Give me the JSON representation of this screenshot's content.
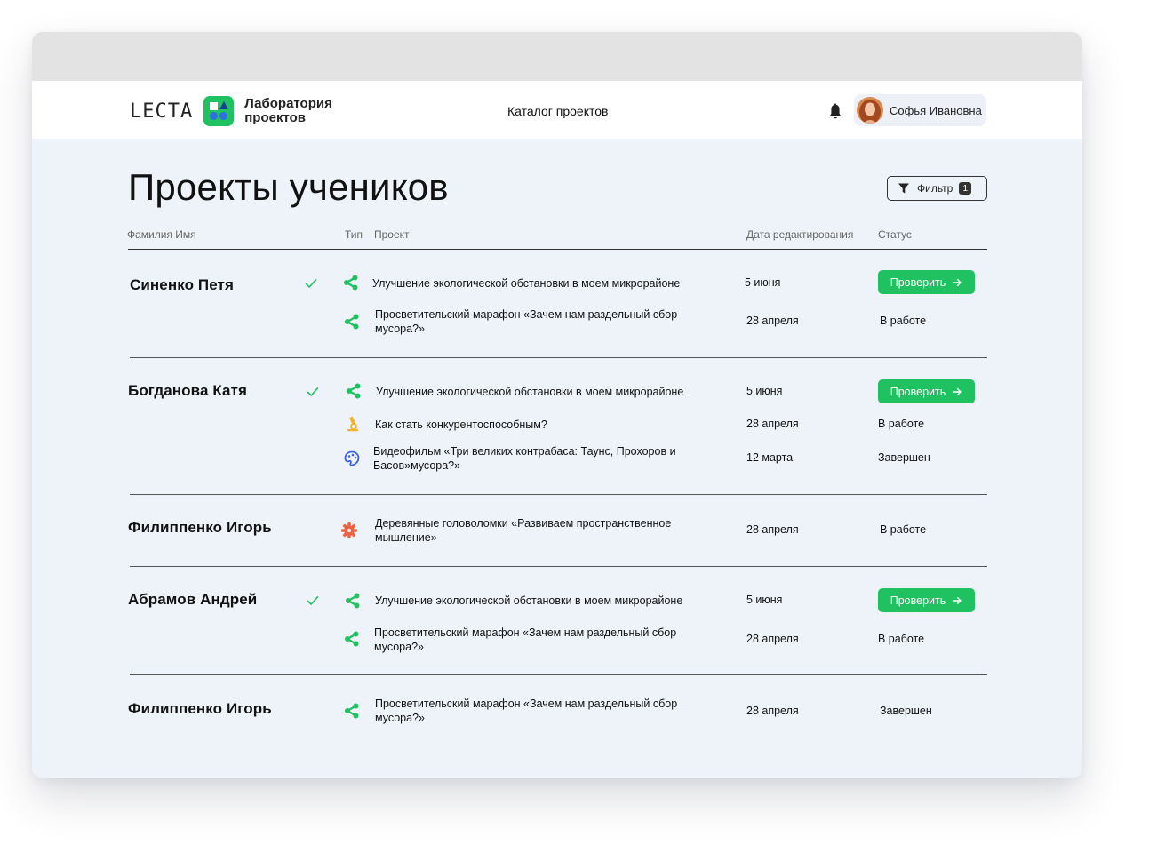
{
  "header": {
    "brand_wordmark": "LECTA",
    "brand_name": "Лаборатория проектов",
    "nav_link": "Каталог проектов",
    "user_name": "Софья Ивановна"
  },
  "page": {
    "title": "Проекты учеников",
    "filter_label": "Фильтр",
    "filter_count": "1"
  },
  "table": {
    "columns": {
      "student": "Фамилия Имя",
      "type": "Тип",
      "project": "Проект",
      "date": "Дата редактирования",
      "status": "Статус"
    },
    "action_label": "Проверить",
    "students": [
      {
        "name": "Синенко Петя",
        "reviewed": true,
        "projects": [
          {
            "type_icon": "share-icon",
            "title": "Улучшение экологической обстановки в моем микрорайоне",
            "date": "5 июня",
            "status": "",
            "action": true
          },
          {
            "type_icon": "share-icon",
            "title": "Просветительский марафон «Зачем нам раздельный сбор мусора?»",
            "date": "28 апреля",
            "status": "В работе",
            "action": false
          }
        ]
      },
      {
        "name": "Богданова Катя",
        "reviewed": true,
        "projects": [
          {
            "type_icon": "share-icon",
            "title": "Улучшение экологической обстановки в моем микрорайоне",
            "date": "5 июня",
            "status": "",
            "action": true
          },
          {
            "type_icon": "microscope-icon",
            "title": "Как стать конкурентоспособным?",
            "date": "28 апреля",
            "status": "В работе",
            "action": false
          },
          {
            "type_icon": "palette-icon",
            "title": "Видеофильм «Три великих контрабаса: Таунс, Прохоров и Басов»мусора?»",
            "date": "12 марта",
            "status": "Завершен",
            "action": false
          }
        ]
      },
      {
        "name": "Филиппенко Игорь",
        "reviewed": false,
        "projects": [
          {
            "type_icon": "gear-icon",
            "title": "Деревянные головоломки «Развиваем пространственное мышление»",
            "date": "28 апреля",
            "status": "В работе",
            "action": false
          }
        ]
      },
      {
        "name": "Абрамов Андрей",
        "reviewed": true,
        "projects": [
          {
            "type_icon": "share-icon",
            "title": "Улучшение экологической обстановки в моем микрорайоне",
            "date": "5 июня",
            "status": "",
            "action": true
          },
          {
            "type_icon": "share-icon",
            "title": "Просветительский марафон «Зачем нам раздельный сбор мусора?»",
            "date": "28 апреля",
            "status": "В работе",
            "action": false
          }
        ]
      },
      {
        "name": "Филиппенко Игорь",
        "reviewed": false,
        "projects": [
          {
            "type_icon": "share-icon",
            "title": "Просветительский марафон «Зачем нам раздельный сбор мусора?»",
            "date": "28 апреля",
            "status": "Завершен",
            "action": false
          }
        ]
      }
    ]
  },
  "colors": {
    "accent_green": "#1fc160",
    "page_background": "#eef3fa",
    "window_titlebar": "#e3e3e3"
  }
}
